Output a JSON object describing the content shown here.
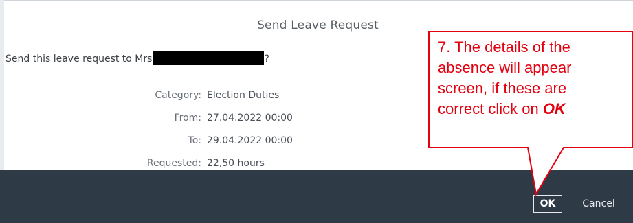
{
  "dialog": {
    "title": "Send Leave Request",
    "prompt_prefix": "Send this leave request to Mrs",
    "prompt_suffix": "?",
    "details": [
      {
        "label": "Category:",
        "value": "Election Duties"
      },
      {
        "label": "From:",
        "value": "27.04.2022 00:00"
      },
      {
        "label": "To:",
        "value": "29.04.2022 00:00"
      },
      {
        "label": "Requested:",
        "value": "22,50 hours"
      }
    ],
    "ok_label": "OK",
    "cancel_label": "Cancel"
  },
  "callout": {
    "line1": "7. The details of the",
    "line2": "absence will appear",
    "line3": "screen, if these are",
    "line4_prefix": "correct click on ",
    "line4_emphasis": "OK",
    "color": "#e3000f"
  },
  "colors": {
    "footer": "#2f3a47",
    "title": "#5a5f66"
  }
}
